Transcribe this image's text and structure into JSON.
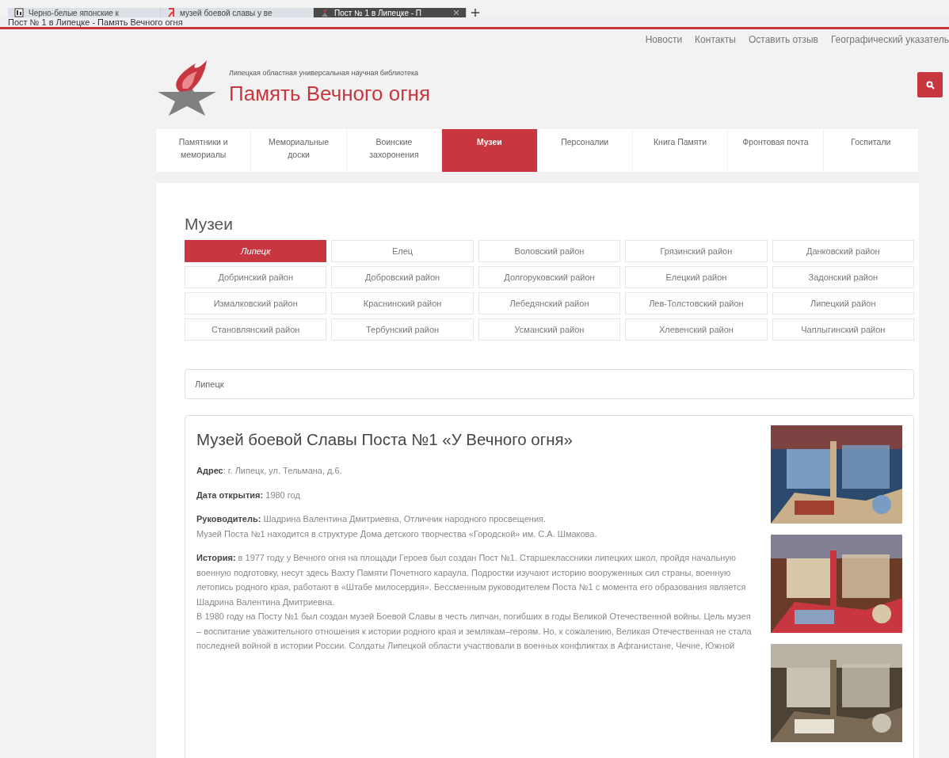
{
  "browser": {
    "tabs": [
      {
        "title": "Черно-белые японские к",
        "kind": "doc",
        "selected": false
      },
      {
        "title": "музей боевой славы у ве",
        "kind": "search",
        "selected": false
      },
      {
        "title": "Пост № 1 в Липецке - П",
        "kind": "site",
        "selected": true
      }
    ],
    "page_title": "Пост № 1 в Липецке - Память Вечного огня"
  },
  "top_links": [
    "Новости",
    "Контакты",
    "Оставить отзыв",
    "Географический указатель"
  ],
  "header": {
    "subtitle": "Липецкая областная универсальная научная библиотека",
    "title": "Память Вечного огня"
  },
  "nav": [
    {
      "label": "Памятники и мемориалы",
      "selected": false
    },
    {
      "label": "Мемориальные доски",
      "selected": false
    },
    {
      "label": "Воинские захоронения",
      "selected": false
    },
    {
      "label": "Музеи",
      "selected": true
    },
    {
      "label": "Персоналии",
      "selected": false
    },
    {
      "label": "Книга Памяти",
      "selected": false
    },
    {
      "label": "Фронтовая почта",
      "selected": false
    },
    {
      "label": "Госпитали",
      "selected": false
    }
  ],
  "section_title": "Музеи",
  "regions": [
    {
      "label": "Липецк",
      "selected": true
    },
    {
      "label": "Елец",
      "selected": false
    },
    {
      "label": "Воловский район",
      "selected": false
    },
    {
      "label": "Грязинский район",
      "selected": false
    },
    {
      "label": "Данковский район",
      "selected": false
    },
    {
      "label": "Добринский район",
      "selected": false
    },
    {
      "label": "Добровский район",
      "selected": false
    },
    {
      "label": "Долгоруковский район",
      "selected": false
    },
    {
      "label": "Елецкий район",
      "selected": false
    },
    {
      "label": "Задонский район",
      "selected": false
    },
    {
      "label": "Измалковский район",
      "selected": false
    },
    {
      "label": "Краснинский район",
      "selected": false
    },
    {
      "label": "Лебедянский район",
      "selected": false
    },
    {
      "label": "Лев-Толстовский район",
      "selected": false
    },
    {
      "label": "Липецкий район",
      "selected": false
    },
    {
      "label": "Становлянский район",
      "selected": false
    },
    {
      "label": "Тербунский район",
      "selected": false
    },
    {
      "label": "Усманский район",
      "selected": false
    },
    {
      "label": "Хлевенский район",
      "selected": false
    },
    {
      "label": "Чаплыгинский район",
      "selected": false
    }
  ],
  "search_field": {
    "value": "Липецк"
  },
  "museum": {
    "title": "Музей боевой Славы Поста №1 «У Вечного огня»",
    "paragraphs": [
      {
        "lines": [
          "**Адрес**: г. Липецк, ул. Тельмана, д.6."
        ]
      },
      {
        "lines": [
          "**Дата открытия:** 1980 год"
        ]
      },
      {
        "lines": [
          "**Руководитель:** Шадрина Валентина Дмитриевна, Отличник народного просвещения.",
          "Музей Поста №1 находится в структуре Дома детского творчества «Городской» им. С.А. Шмакова."
        ]
      },
      {
        "lines": [
          "**История:** в 1977 году у Вечного огня на площади Героев был создан Пост №1. Старшеклассники липецких школ, пройдя начальную военную подготовку, несут здесь Вахту Памяти Почетного караула. Подростки изучают историю вооруженных сил страны, военную летопись родного края, работают в «Штабе милосердия». Бессменным руководителем Поста №1 с момента его образования является Шадрина Валентина Дмитриевна.",
          "В 1980 году на Посту №1 был создан музей Боевой Славы в честь липчан, погибших в годы Великой Отечественной войны. Цель музея – воспитание уважительного отношения к истории родного края и землякам–героям. Но, к сожалению, Великая Отечественная не стала последней войной в истории России. Солдаты Липецкой области участвовали в военных конфликтах в Афганистане, Чечне, Южной"
        ]
      }
    ]
  }
}
